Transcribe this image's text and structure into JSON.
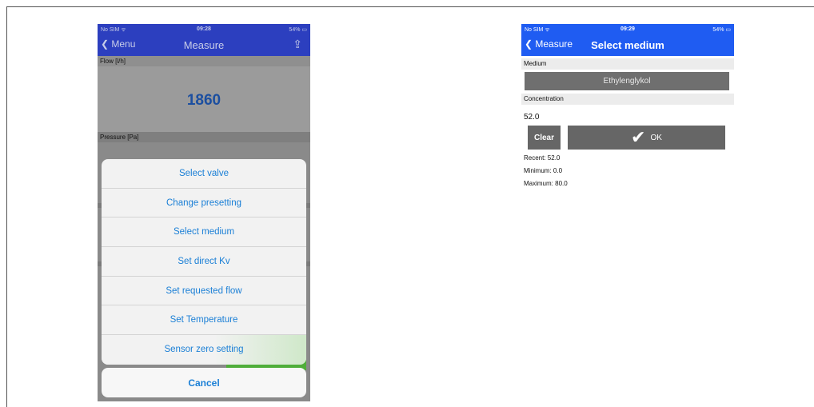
{
  "left_screen": {
    "status": {
      "carrier": "No SIM ᯤ",
      "time": "09:28",
      "battery": "54% ▭"
    },
    "nav": {
      "back_label": "❮ Menu",
      "title": "Measure",
      "action_icon": "⇪"
    },
    "flow": {
      "label": "Flow [l/h]",
      "value": "1860"
    },
    "pressure": {
      "label": "Pressure [Pa]"
    },
    "action_sheet": {
      "items": [
        {
          "label": "Select valve"
        },
        {
          "label": "Change presetting"
        },
        {
          "label": "Select medium"
        },
        {
          "label": "Set direct Kv"
        },
        {
          "label": "Set requested flow"
        },
        {
          "label": "Set Temperature"
        },
        {
          "label": "Sensor zero setting"
        }
      ],
      "cancel_label": "Cancel"
    }
  },
  "right_screen": {
    "status": {
      "carrier": "No SIM ᯤ",
      "time": "09:29",
      "battery": "54% ▭"
    },
    "nav": {
      "back_label": "❮ Measure",
      "title": "Select medium"
    },
    "medium": {
      "label": "Medium",
      "value": "Ethylenglykol"
    },
    "concentration": {
      "label": "Concentration",
      "value": "52.0"
    },
    "buttons": {
      "clear_label": "Clear",
      "ok_label": "OK",
      "ok_icon": "✔"
    },
    "stats": {
      "recent": "Recent: 52.0",
      "minimum": "Minimum: 0.0",
      "maximum": "Maximum: 80.0"
    }
  },
  "colors": {
    "nav_blue_dimmed": "#2c3fbf",
    "nav_blue": "#1f5cf2",
    "link_blue": "#1a7fd6",
    "value_blue": "#1c4fa0",
    "button_gray": "#666666"
  }
}
